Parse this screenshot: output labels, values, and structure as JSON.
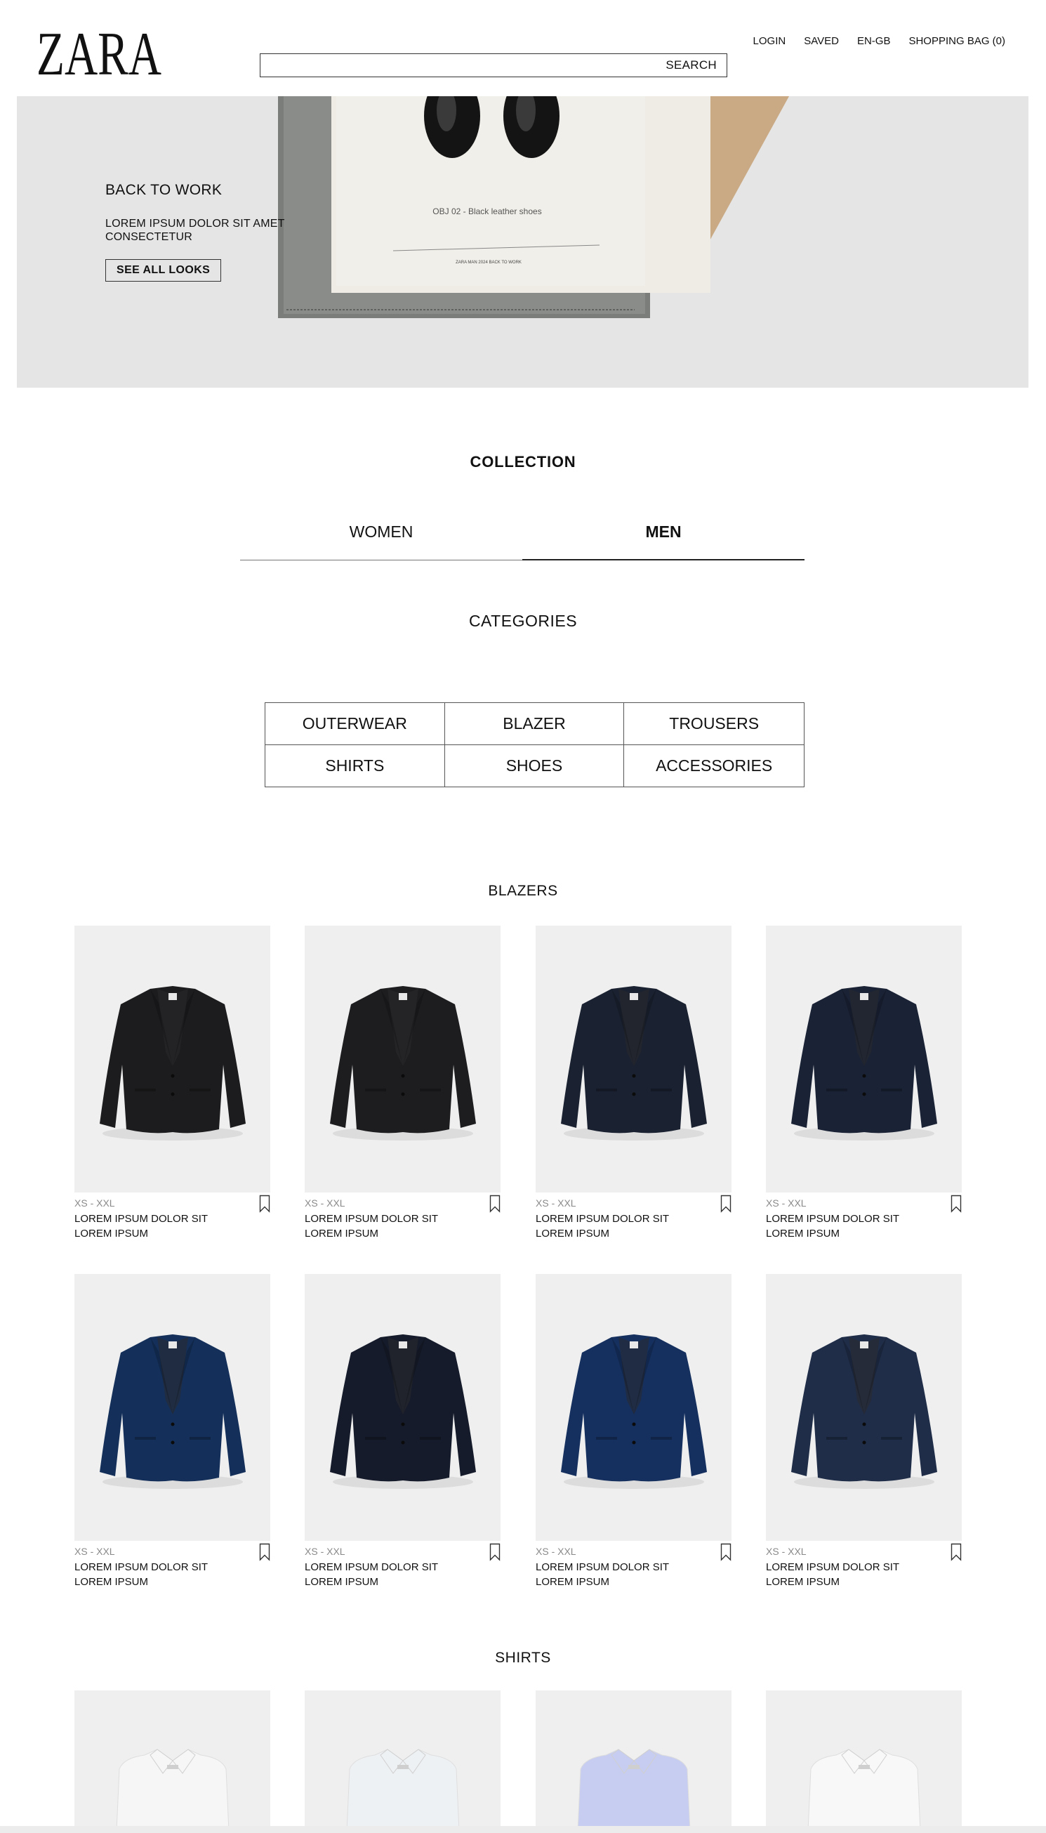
{
  "header": {
    "logo_text": "ZARA",
    "search_button": "SEARCH",
    "search_value": "",
    "nav": [
      "LOGIN",
      "SAVED",
      "EN-GB",
      "SHOPPING BAG (0)"
    ]
  },
  "hero": {
    "title": "BACK TO WORK",
    "subtitle": "LOREM IPSUM DOLOR SIT AMET CONSECTETUR",
    "button": "SEE ALL LOOKS",
    "card_text": "OBJ 02 - Black leather shoes",
    "card_footer": "ZARA MAN 2024 BACK TO WORK"
  },
  "collection": {
    "title": "COLLECTION",
    "tabs": [
      {
        "label": "WOMEN",
        "active": false
      },
      {
        "label": "MEN",
        "active": true
      }
    ]
  },
  "categories": {
    "title": "CATEGORIES",
    "items": [
      "OUTERWEAR",
      "BLAZER",
      "TROUSERS",
      "SHIRTS",
      "SHOES",
      "ACCESSORIES"
    ]
  },
  "blazers": {
    "title": "BLAZERS",
    "products": [
      {
        "size": "XS - XXL",
        "name": "LOREM IPSUM DOLOR SIT LOREM IPSUM",
        "color": "#1c1c1e"
      },
      {
        "size": "XS - XXL",
        "name": "LOREM IPSUM DOLOR SIT LOREM IPSUM",
        "color": "#1d1d20"
      },
      {
        "size": "XS - XXL",
        "name": "LOREM IPSUM DOLOR SIT LOREM IPSUM",
        "color": "#1a2130"
      },
      {
        "size": "XS - XXL",
        "name": "LOREM IPSUM DOLOR SIT LOREM IPSUM",
        "color": "#1a2235"
      },
      {
        "size": "XS - XXL",
        "name": "LOREM IPSUM DOLOR SIT LOREM IPSUM",
        "color": "#14305a"
      },
      {
        "size": "XS - XXL",
        "name": "LOREM IPSUM DOLOR SIT LOREM IPSUM",
        "color": "#151b2a"
      },
      {
        "size": "XS - XXL",
        "name": "LOREM IPSUM DOLOR SIT LOREM IPSUM",
        "color": "#15305e"
      },
      {
        "size": "XS - XXL",
        "name": "LOREM IPSUM DOLOR SIT LOREM IPSUM",
        "color": "#1f2d48"
      }
    ]
  },
  "shirts": {
    "title": "SHIRTS",
    "products": [
      {
        "color": "#f6f6f6"
      },
      {
        "color": "#eef1f4"
      },
      {
        "color": "#c7cdf0"
      },
      {
        "color": "#f8f8f8"
      }
    ]
  },
  "colors": {
    "background": "#ffffff",
    "hero_bg": "#e4e4e4",
    "image_bg": "#efefef",
    "text": "#111111",
    "muted": "#8a8a8a"
  }
}
